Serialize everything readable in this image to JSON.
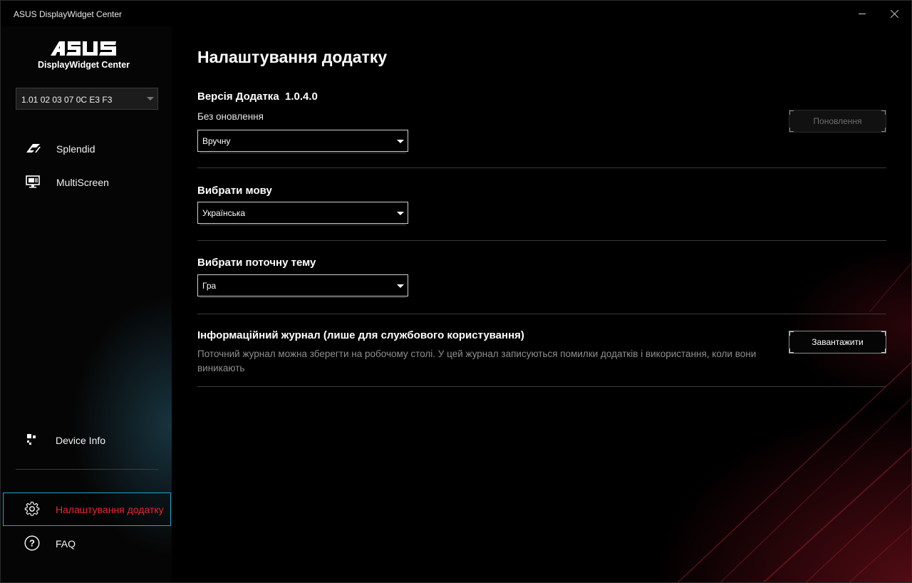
{
  "window": {
    "title": "ASUS DisplayWidget Center"
  },
  "brand": {
    "logo_text": "ASUS",
    "subtitle": "DisplayWidget Center"
  },
  "device": {
    "selected": "1.01 02 03 07 0C E3 F3"
  },
  "sidebar": {
    "items": [
      {
        "label": "Splendid",
        "icon": "splendid-icon"
      },
      {
        "label": "MultiScreen",
        "icon": "monitor-icon"
      }
    ],
    "bottom": [
      {
        "label": "Device Info",
        "icon": "device-info-icon"
      },
      {
        "label": "Налаштування додатку",
        "icon": "gear-icon",
        "active": true
      },
      {
        "label": "FAQ",
        "icon": "question-icon"
      }
    ]
  },
  "main": {
    "title": "Налаштування додатку",
    "version": {
      "label": "Версія Додатка",
      "value": "1.0.4.0",
      "status": "Без оновлення",
      "mode": "Вручну",
      "update_button": "Поновлення"
    },
    "language": {
      "label": "Вибрати мову",
      "value": "Українська"
    },
    "theme": {
      "label": "Вибрати поточну тему",
      "value": "Гра"
    },
    "log": {
      "label": "Інформаційний журнал (лише для службового користування)",
      "description": "Поточний журнал можна зберегти на робочому столі. У цей журнал записуються помилки додатків і використання, коли вони виникають",
      "download_button": "Завантажити"
    }
  },
  "colors": {
    "accent_red": "#e6262f",
    "active_border": "#26a3c6",
    "background": "#000000"
  }
}
